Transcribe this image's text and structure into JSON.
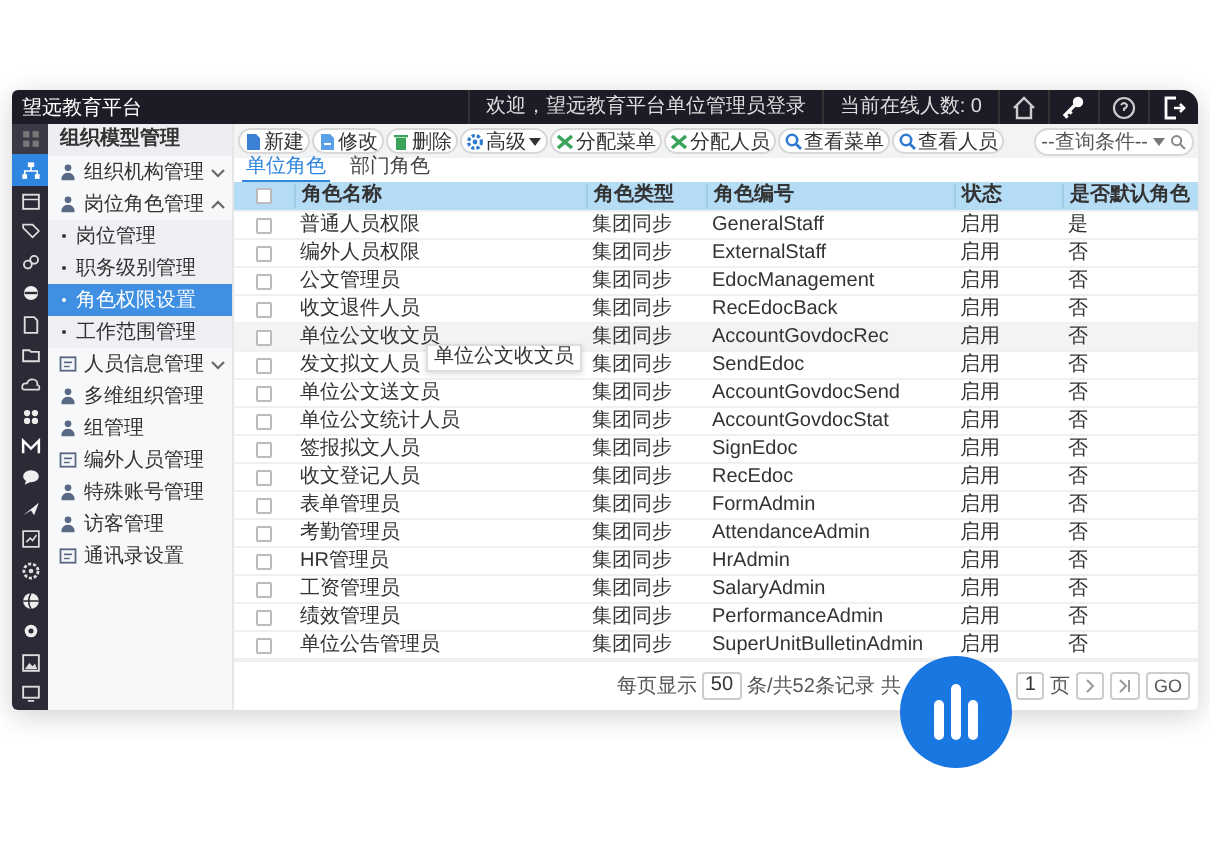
{
  "window": {
    "title": "望远教育平台"
  },
  "top_bar": {
    "welcome": "欢迎，望远教育平台单位管理员登录",
    "online": "当前在线人数: 0"
  },
  "icon_rail": [
    {
      "selected": false
    },
    {
      "selected": true
    },
    {
      "selected": false
    },
    {
      "selected": false
    },
    {
      "selected": false
    },
    {
      "selected": false
    },
    {
      "selected": false
    },
    {
      "selected": false
    },
    {
      "selected": false
    },
    {
      "selected": false
    },
    {
      "selected": false
    },
    {
      "selected": false
    },
    {
      "selected": false
    },
    {
      "selected": false
    },
    {
      "selected": false
    },
    {
      "selected": false
    },
    {
      "selected": false
    },
    {
      "selected": false
    },
    {
      "selected": false
    }
  ],
  "sidebar": {
    "title": "组织模型管理",
    "items": [
      {
        "label": "组织机构管理",
        "expandable": true,
        "expanded": false
      },
      {
        "label": "岗位角色管理",
        "expandable": true,
        "expanded": true,
        "children": [
          {
            "label": "岗位管理",
            "selected": false
          },
          {
            "label": "职务级别管理",
            "selected": false
          },
          {
            "label": "角色权限设置",
            "selected": true
          },
          {
            "label": "工作范围管理",
            "selected": false
          }
        ]
      },
      {
        "label": "人员信息管理",
        "expandable": true,
        "expanded": false
      },
      {
        "label": "多维组织管理",
        "expandable": false
      },
      {
        "label": "组管理",
        "expandable": false
      },
      {
        "label": "编外人员管理",
        "expandable": false
      },
      {
        "label": "特殊账号管理",
        "expandable": false
      },
      {
        "label": "访客管理",
        "expandable": false
      },
      {
        "label": "通讯录设置",
        "expandable": false
      }
    ]
  },
  "toolbar": {
    "buttons": [
      {
        "label": "新建",
        "dropdown": false
      },
      {
        "label": "修改",
        "dropdown": false
      },
      {
        "label": "删除",
        "dropdown": false
      },
      {
        "label": "高级",
        "dropdown": true
      },
      {
        "label": "分配菜单",
        "dropdown": false
      },
      {
        "label": "分配人员",
        "dropdown": false
      },
      {
        "label": "查看菜单",
        "dropdown": false
      },
      {
        "label": "查看人员",
        "dropdown": false
      }
    ],
    "query": {
      "value": "--查询条件--"
    }
  },
  "tabs": [
    {
      "label": "单位角色",
      "selected": true
    },
    {
      "label": "部门角色",
      "selected": false
    }
  ],
  "table": {
    "header_checkbox": {
      "checked": false
    },
    "columns": [
      "角色名称",
      "角色类型",
      "角色编号",
      "状态",
      "是否默认角色"
    ],
    "rows": [
      {
        "checked": false,
        "hovered": false,
        "cells": [
          "普通人员权限",
          "集团同步",
          "GeneralStaff",
          "启用",
          "是"
        ]
      },
      {
        "checked": false,
        "hovered": false,
        "cells": [
          "编外人员权限",
          "集团同步",
          "ExternalStaff",
          "启用",
          "否"
        ]
      },
      {
        "checked": false,
        "hovered": false,
        "cells": [
          "公文管理员",
          "集团同步",
          "EdocManagement",
          "启用",
          "否"
        ]
      },
      {
        "checked": false,
        "hovered": false,
        "cells": [
          "收文退件人员",
          "集团同步",
          "RecEdocBack",
          "启用",
          "否"
        ]
      },
      {
        "checked": false,
        "hovered": true,
        "tooltip": "单位公文收文员",
        "cells": [
          "单位公文收文员",
          "集团同步",
          "AccountGovdocRec",
          "启用",
          "否"
        ]
      },
      {
        "checked": false,
        "hovered": false,
        "cells": [
          "发文拟文人员",
          "集团同步",
          "SendEdoc",
          "启用",
          "否"
        ]
      },
      {
        "checked": false,
        "hovered": false,
        "cells": [
          "单位公文送文员",
          "集团同步",
          "AccountGovdocSend",
          "启用",
          "否"
        ]
      },
      {
        "checked": false,
        "hovered": false,
        "cells": [
          "单位公文统计人员",
          "集团同步",
          "AccountGovdocStat",
          "启用",
          "否"
        ]
      },
      {
        "checked": false,
        "hovered": false,
        "cells": [
          "签报拟文人员",
          "集团同步",
          "SignEdoc",
          "启用",
          "否"
        ]
      },
      {
        "checked": false,
        "hovered": false,
        "cells": [
          "收文登记人员",
          "集团同步",
          "RecEdoc",
          "启用",
          "否"
        ]
      },
      {
        "checked": false,
        "hovered": false,
        "cells": [
          "表单管理员",
          "集团同步",
          "FormAdmin",
          "启用",
          "否"
        ]
      },
      {
        "checked": false,
        "hovered": false,
        "cells": [
          "考勤管理员",
          "集团同步",
          "AttendanceAdmin",
          "启用",
          "否"
        ]
      },
      {
        "checked": false,
        "hovered": false,
        "cells": [
          "HR管理员",
          "集团同步",
          "HrAdmin",
          "启用",
          "否"
        ]
      },
      {
        "checked": false,
        "hovered": false,
        "cells": [
          "工资管理员",
          "集团同步",
          "SalaryAdmin",
          "启用",
          "否"
        ]
      },
      {
        "checked": false,
        "hovered": false,
        "cells": [
          "绩效管理员",
          "集团同步",
          "PerformanceAdmin",
          "启用",
          "否"
        ]
      },
      {
        "checked": false,
        "hovered": false,
        "cells": [
          "单位公告管理员",
          "集团同步",
          "SuperUnitBulletinAdmin",
          "启用",
          "否"
        ]
      }
    ]
  },
  "pagination": {
    "per_page_label": "每页显示",
    "per_page": "50",
    "records": "条/共52条记录",
    "total_prefix": "共",
    "page": "1",
    "page_suffix": "页",
    "go": "GO"
  }
}
